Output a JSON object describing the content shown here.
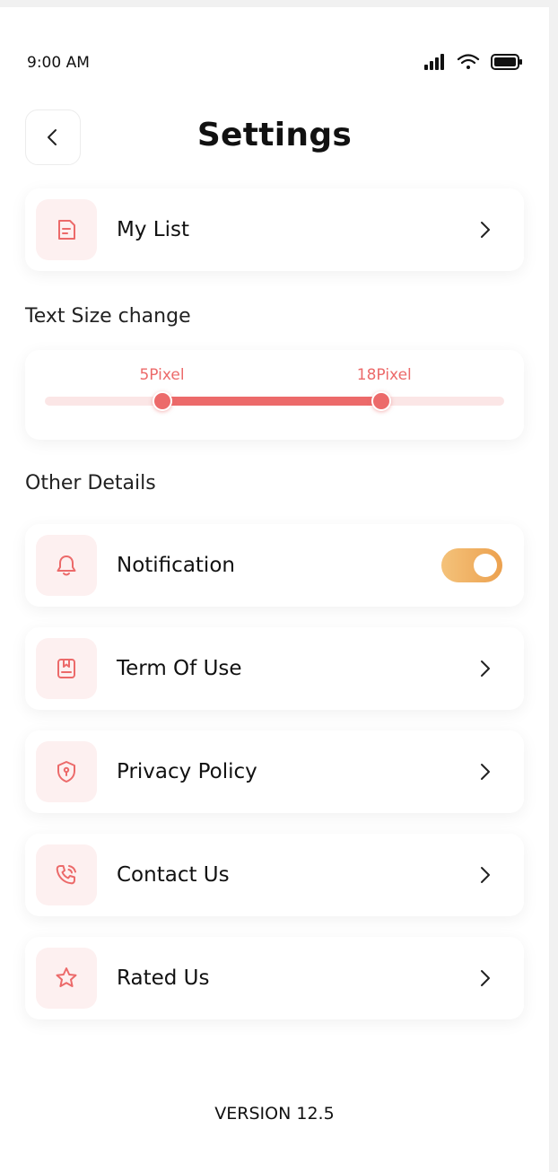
{
  "status_bar": {
    "time": "9:00 AM",
    "icons": [
      "signal-icon",
      "wifi-icon",
      "battery-icon"
    ]
  },
  "header": {
    "title": "Settings",
    "back_icon": "chevron-left-icon"
  },
  "my_list": {
    "label": "My List",
    "icon": "document-list-icon"
  },
  "text_size": {
    "section_title": "Text Size change",
    "min_label": "5Pixel",
    "max_label": "18Pixel",
    "range_start_fraction": 0.255,
    "range_end_fraction": 0.733
  },
  "other_details": {
    "section_title": "Other Details",
    "items": [
      {
        "label": "Notification",
        "icon": "bell-icon",
        "toggle_on": true
      },
      {
        "label": "Term Of Use",
        "icon": "bookmark-doc-icon"
      },
      {
        "label": "Privacy Policy",
        "icon": "shield-icon"
      },
      {
        "label": "Contact Us",
        "icon": "phone-icon"
      },
      {
        "label": "Rated Us",
        "icon": "star-icon"
      }
    ]
  },
  "version": "VERSION 12.5",
  "colors": {
    "accent": "#ec6a6a",
    "icon_bg": "#fdf0f0",
    "toggle": "#eca14f"
  }
}
